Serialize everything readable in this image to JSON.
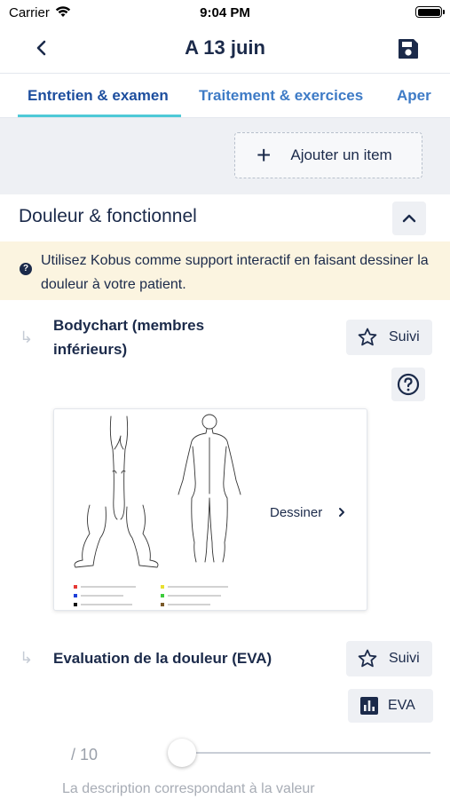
{
  "status_bar": {
    "carrier": "Carrier",
    "time": "9:04 PM"
  },
  "nav": {
    "title": "A 13 juin"
  },
  "tabs": [
    {
      "label": "Entretien & examen"
    },
    {
      "label": "Traitement & exercices"
    },
    {
      "label": "Aper"
    }
  ],
  "toolbar": {
    "add_item_label": "Ajouter un item"
  },
  "section": {
    "title": "Douleur & fonctionnel"
  },
  "banner": {
    "text": "Utilisez Kobus comme support interactif en faisant dessiner la douleur à votre patient.",
    "icon": "question-icon"
  },
  "items": [
    {
      "title": "Bodychart (membres inférieurs)",
      "follow_label": "Suivi",
      "action_label": "Dessiner"
    },
    {
      "title": "Evaluation de la douleur (EVA)",
      "follow_label": "Suivi",
      "scale_button_label": "EVA",
      "slider_suffix": "/ 10",
      "description_placeholder": "La description correspondant à la valeur",
      "slider_value": 0
    }
  ],
  "colors": {
    "primary": "#1b2a4a",
    "tab_active": "#1d4e9e",
    "tab_inactive": "#3e7bc6",
    "tab_indicator": "#4ec9d7",
    "banner_bg": "#fbf4e0",
    "chip_bg": "#eef0f4"
  }
}
